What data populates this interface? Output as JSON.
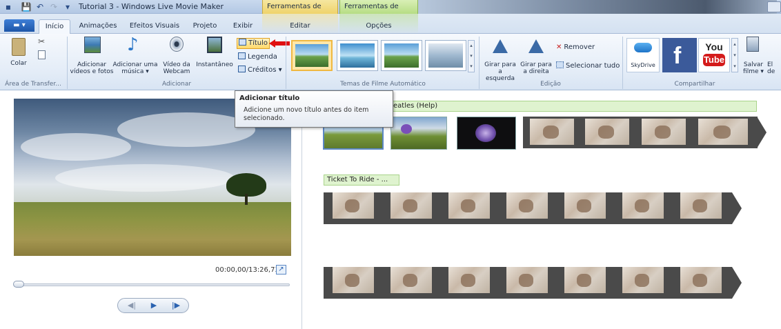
{
  "window": {
    "title": "Tutorial 3 - Windows Live Movie Maker"
  },
  "contextual_tabs": {
    "video": "Ferramentas de Vídeo",
    "music": "Ferramentas de Música"
  },
  "tabs": [
    {
      "label": "Início"
    },
    {
      "label": "Animações"
    },
    {
      "label": "Efeitos Visuais"
    },
    {
      "label": "Projeto"
    },
    {
      "label": "Exibir"
    },
    {
      "label": "Editar"
    },
    {
      "label": "Opções"
    }
  ],
  "ribbon": {
    "clipboard": {
      "paste": "Colar",
      "group": "Área de Transfer..."
    },
    "add": {
      "add_videos": "Adicionar vídeos e fotos",
      "add_music": "Adicionar uma música",
      "add_music_arrow": "▾",
      "webcam": "Vídeo da Webcam",
      "snapshot": "Instantâneo",
      "title": "Título",
      "caption": "Legenda",
      "credits": "Créditos",
      "credits_arrow": "▾",
      "group": "Adicionar"
    },
    "themes": {
      "group": "Temas de Filme Automático"
    },
    "edit": {
      "rotate_left": "Girar para a esquerda",
      "rotate_right": "Girar para a direita",
      "remove": "Remover",
      "select_all": "Selecionar tudo",
      "group": "Edição"
    },
    "share": {
      "skydrive": "SkyDrive",
      "youtube_top": "You",
      "youtube_bottom": "Tube",
      "save_movie": "Salvar filme",
      "save_arrow": "▾",
      "next": "El de",
      "group": "Compartilhar"
    }
  },
  "tooltip": {
    "title": "Adicionar título",
    "description": "Adicione um novo título antes do item selecionado."
  },
  "preview": {
    "timecode": "00:00,00/13:26,73"
  },
  "storyboard": {
    "music_label_1": "eatles (Help)",
    "music_label_2": "Ticket To Ride - ..."
  },
  "colors": {
    "accent_red": "#e01010",
    "music_green": "#dff3cf"
  }
}
